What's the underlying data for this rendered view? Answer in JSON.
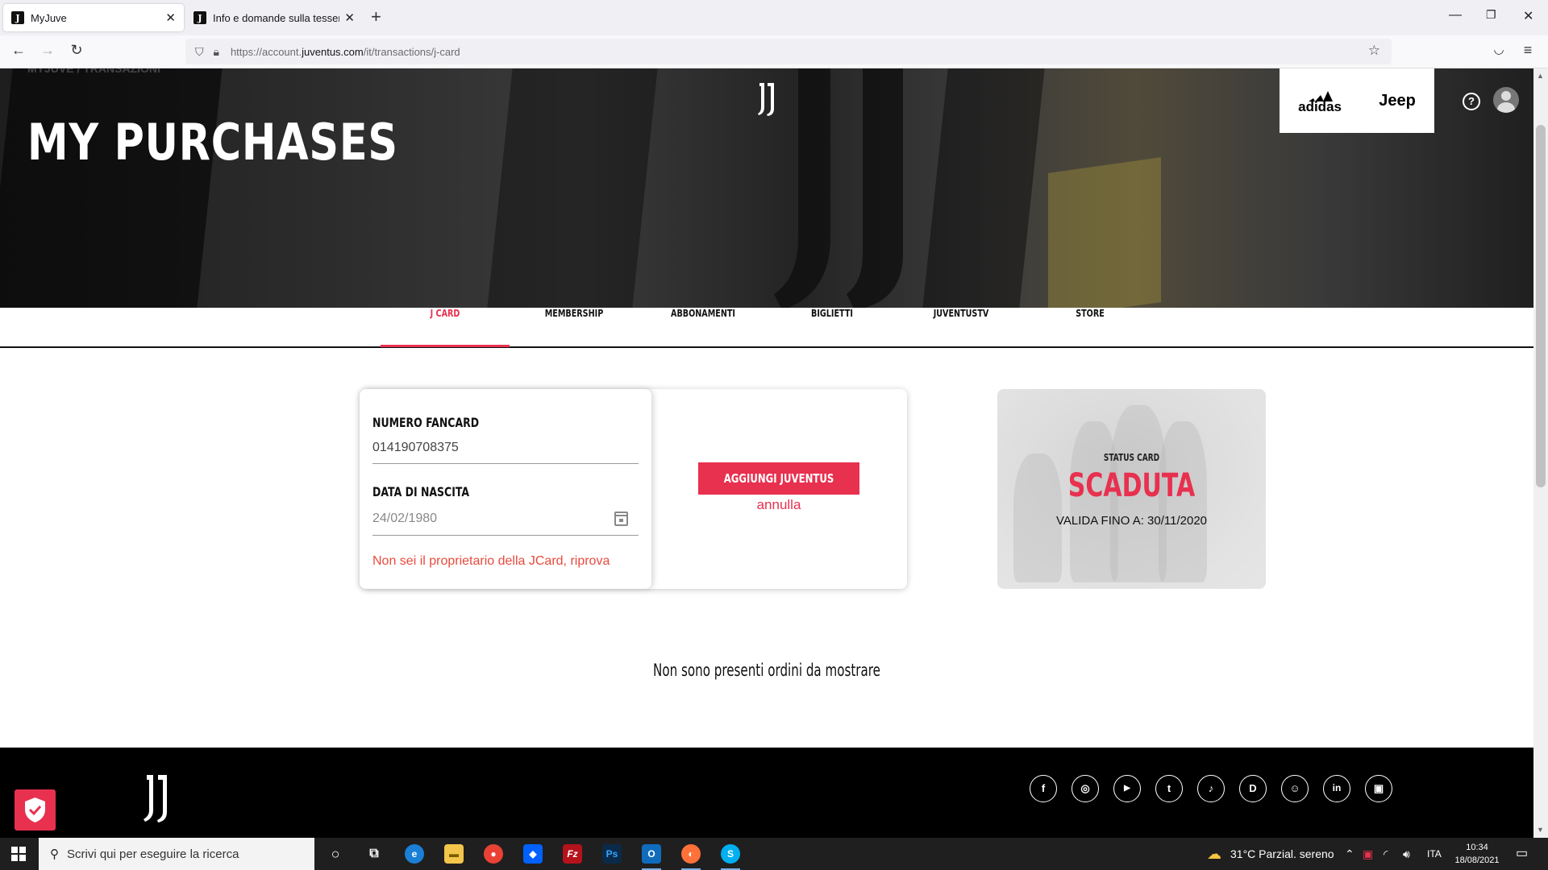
{
  "browser": {
    "tabs": [
      {
        "title": "MyJuve",
        "favicon": "J",
        "active": true
      },
      {
        "title": "Info e domande sulla tessera del",
        "favicon": "J",
        "active": false
      }
    ],
    "url_prefix": "https://account.",
    "url_domain": "juventus.com",
    "url_path": "/it/transactions/j-card"
  },
  "hero": {
    "breadcrumb": "MYJUVE / TRANSAZIONI",
    "title": "MY PURCHASES"
  },
  "sponsors": {
    "adidas": "adidas",
    "jeep": "Jeep"
  },
  "header": {
    "help_label": "?"
  },
  "nav_tabs": [
    {
      "label": "J CARD"
    },
    {
      "label": "MEMBERSHIP"
    },
    {
      "label": "ABBONAMENTI"
    },
    {
      "label": "BIGLIETTI"
    },
    {
      "label": "JUVENTUSTV"
    },
    {
      "label": "STORE"
    }
  ],
  "active_tab": "J CARD",
  "jcard_form": {
    "fancard_label": "NUMERO FANCARD",
    "fancard_value": "014190708375",
    "birth_label": "DATA DI NASCITA",
    "birth_placeholder": "24/02/1980",
    "error_message": "Non sei il proprietario della JCard, riprova",
    "add_button": "AGGIUNGI JUVENTUS CARD",
    "cancel_link": "annulla"
  },
  "status_card": {
    "caption": "STATUS CARD",
    "status": "SCADUTA",
    "valid_until": "VALIDA FINO A: 30/11/2020"
  },
  "orders": {
    "empty_message": "Non sono presenti ordini da mostrare"
  },
  "social_icons": [
    "facebook-icon",
    "instagram-icon",
    "youtube-icon",
    "twitter-icon",
    "tiktok-icon",
    "dazn-icon",
    "snapchat-icon",
    "linkedin-icon",
    "twitch-icon"
  ],
  "taskbar": {
    "search_placeholder": "Scrivi qui per eseguire la ricerca",
    "weather": "31°C  Parzial. sereno",
    "language": "ITA",
    "time": "10:34",
    "date": "18/08/2021"
  },
  "colors": {
    "accent": "#e8304f",
    "footer": "#000000",
    "hero": "#2b2b2b"
  }
}
